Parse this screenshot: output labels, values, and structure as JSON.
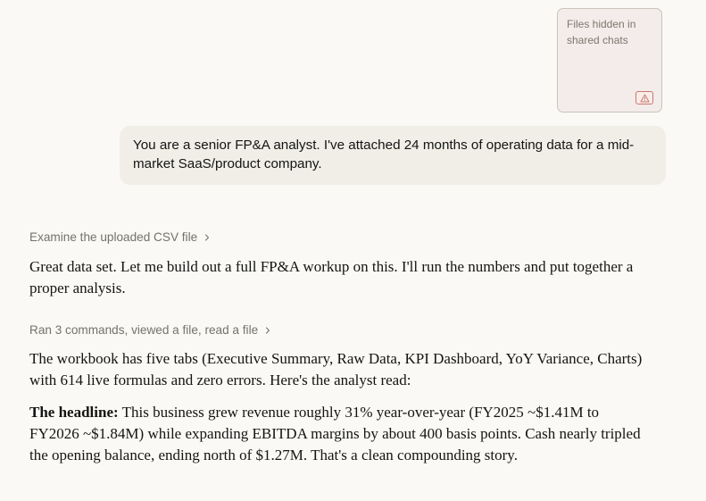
{
  "file_card": {
    "text": "Files hidden in shared chats",
    "icon": "warning-triangle-icon"
  },
  "user_message": {
    "text": "You are a senior FP&A analyst. I've attached 24 months of operating data for a mid-market SaaS/product company."
  },
  "assistant": {
    "step1": {
      "label": "Examine the uploaded CSV file",
      "icon": "chevron-right-icon"
    },
    "para1": "Great data set. Let me build out a full FP&A workup on this. I'll run the numbers and put together a proper analysis.",
    "step2": {
      "label": "Ran 3 commands, viewed a file, read a file",
      "icon": "chevron-right-icon"
    },
    "para2": "The workbook has five tabs (Executive Summary, Raw Data, KPI Dashboard, YoY Variance, Charts) with 614 live formulas and zero errors. Here's the analyst read:",
    "para3": {
      "lead": "The headline:",
      "body": " This business grew revenue roughly 31% year-over-year (FY2025 ~$1.41M to FY2026 ~$1.84M) while expanding EBITDA margins by about 400 basis points. Cash nearly tripled the opening balance, ending north of $1.27M. That's a clean compounding story."
    }
  },
  "colors": {
    "background": "#faf9f5",
    "bubble": "#f0eee6",
    "file_card": "#f3ecea",
    "warning": "#c9786f",
    "muted_text": "#73726c",
    "text": "#141413"
  }
}
